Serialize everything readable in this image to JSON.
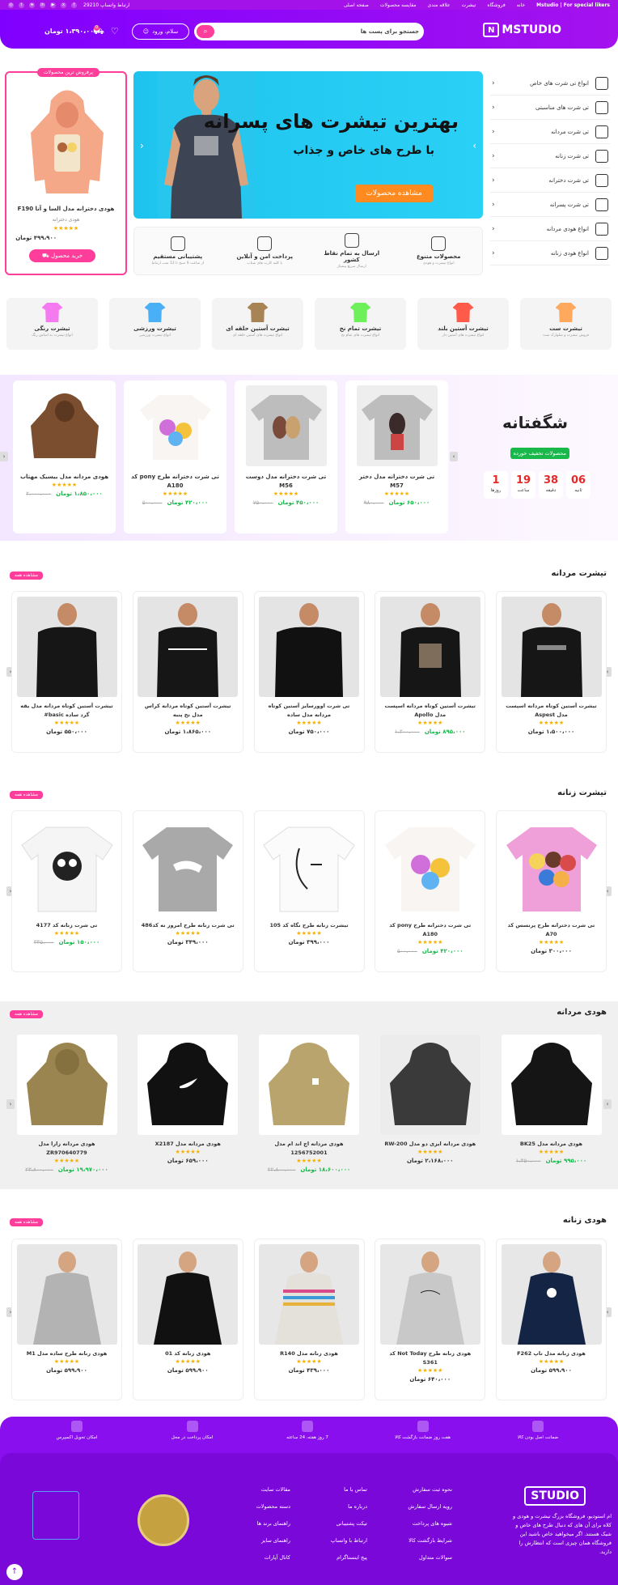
{
  "topbar": {
    "tagline": "Mstudio | For special likers",
    "links": [
      "خانه",
      "فروشگاه",
      "تیشرت",
      "علاقه مندی",
      "مقایسه محصولات",
      "صفحه اصلی"
    ],
    "phone": "ارتباط واتساپ 29210"
  },
  "header": {
    "logo": "MSTUDIO",
    "search_placeholder": "جستجو برای پست ها",
    "login": "سلام، ورود",
    "cart_count": "0",
    "cart_total": "۱،۳۹۰،۰۰۰ تومان"
  },
  "categories": [
    "انواع تی شرت های خاص",
    "تی شرت های مناسبتی",
    "تی شرت مردانه",
    "تی شرت زنانه",
    "تی شرت دخترانه",
    "تی شرت پسرانه",
    "انواع هودی مردانه",
    "انواع هودی زنانه"
  ],
  "banner": {
    "title": "بهترین تیشرت های پسرانه",
    "subtitle": "با طرح های خاص و جذاب",
    "cta": "مشاهده محصولات"
  },
  "features": [
    {
      "title": "محصولات متنوع",
      "sub": "انواع تیشرت و هودی"
    },
    {
      "title": "ارسال به تمام نقاط کشور",
      "sub": "ارسال سریع پیشتاز"
    },
    {
      "title": "پرداخت امن و آنلاین",
      "sub": "با کلیه کارت های شتاب"
    },
    {
      "title": "پشتیبانی مستقیم",
      "sub": "از ساعت 9 صبح تا 12 شب ارتباط"
    }
  ],
  "offer": {
    "tag": "پرفروش ترین محصولات",
    "name": "هودی دخترانه مدل السا و آنا F190",
    "sub": "هودی دخترانه",
    "price": "۴۹۹،۹۰۰ تومان",
    "buy": "خرید محصول"
  },
  "tiles": [
    {
      "title": "تیشرت ست",
      "sub": "فروش تیشرت و شلوارک ست"
    },
    {
      "title": "تیشرت آستین بلند",
      "sub": "انواع تیشرت های آستین دار"
    },
    {
      "title": "تیشرت تمام نخ",
      "sub": "انواع تیشرت های تمام نخ"
    },
    {
      "title": "تیشرت آستین حلقه ای",
      "sub": "انواع تیشرت های آستین حلقه ای"
    },
    {
      "title": "تیشرت ورزشی",
      "sub": "انواع تیشرت ورزشی"
    },
    {
      "title": "تیشرت رنگی",
      "sub": "انواع تیشرت به اساس رنگ"
    }
  ],
  "amazing": {
    "title": "شگفتانه",
    "badge": "محصولات تخفیف خورده",
    "timer": [
      {
        "value": "06",
        "label": "ثانیه"
      },
      {
        "value": "38",
        "label": "دقیقه"
      },
      {
        "value": "19",
        "label": "ساعت"
      },
      {
        "value": "1",
        "label": "روزها"
      }
    ],
    "products": [
      {
        "name": "هودی مردانه مدل بیسیک مهتاب",
        "old": "۲،۰۰۰،۰۰۰",
        "new": "۱،۸۵۰،۰۰۰ تومان"
      },
      {
        "name": "تی شرت دخترانه طرح pony کد A180",
        "old": "۵۰۰،۰۰۰",
        "new": "۴۲۰،۰۰۰ تومان"
      },
      {
        "name": "تی شرت دخترانه مدل دوست M56",
        "old": "۷۵۰،۰۰۰",
        "new": "۴۵۰،۰۰۰ تومان"
      },
      {
        "name": "تی شرت دخترانه مدل دختر M57",
        "old": "۹۸۰،۰۰۰",
        "new": "۶۵۰،۰۰۰ تومان"
      }
    ]
  },
  "sections": [
    {
      "title": "تیشرت مردانه",
      "more": "مشاهده همه",
      "products": [
        {
          "name": "تیشرت آستین کوتاه مردانه مدل یقه گرد ساده basic#",
          "old": "",
          "price": "۵۵۰،۰۰۰ تومان"
        },
        {
          "name": "تیشرت آستین کوتاه مردانه کراس مدل نخ پنبه",
          "old": "",
          "price": "۱،۸۶۵،۰۰۰ تومان"
        },
        {
          "name": "تی شرت اوورسایز آستین کوتاه مردانه مدل ساده",
          "old": "",
          "price": "۷۵۰،۰۰۰ تومان"
        },
        {
          "name": "تیشرت آستین کوتاه مردانه اسپست مدل Apollo",
          "old": "۱،۲۰۰،۰۰۰",
          "price": "۸۹۵،۰۰۰ تومان"
        },
        {
          "name": "تیشرت آستین کوتاه مردانه اسپست مدل Aspest",
          "old": "",
          "price": "۱،۵۰۰،۰۰۰ تومان"
        }
      ]
    },
    {
      "title": "تیشرت زنانه",
      "more": "مشاهده همه",
      "products": [
        {
          "name": "تی شرت زنانه کد 4177",
          "old": "۳۳۵،۰۰۰",
          "price": "۱۵۰،۰۰۰ تومان"
        },
        {
          "name": "تی شرت زنانه طرح امروز نه کد486",
          "old": "",
          "price": "۳۴۹،۰۰۰ تومان"
        },
        {
          "name": "تیشرت زنانه طرح نگاه کد 105",
          "old": "",
          "price": "۳۹۹،۰۰۰ تومان"
        },
        {
          "name": "تی شرت دخترانه طرح pony کد A180",
          "old": "۵۰۰،۰۰۰",
          "price": "۴۲۰،۰۰۰ تومان"
        },
        {
          "name": "تی شرت دخترانه طرح پرنسس کد A70",
          "old": "",
          "price": "۳۰۰،۰۰۰ تومان"
        }
      ]
    },
    {
      "title": "هودی مردانه",
      "more": "مشاهده همه",
      "products": [
        {
          "name": "هودی مردانه زارا مدل ZR970640779",
          "old": "۲۳،۸۰۰،۰۰۰",
          "price": "۱۹،۹۷۰،۰۰۰ تومان"
        },
        {
          "name": "هودی مردانه مدل X2187",
          "old": "",
          "price": "۶۵۹،۰۰۰ تومان"
        },
        {
          "name": "هودی مردانه اچ اند ام مدل 1256752001",
          "old": "۲۲،۸۰۰،۰۰۰",
          "price": "۱۸،۶۰۰،۰۰۰ تومان"
        },
        {
          "name": "هودی مردانه ایزی دو مدل RW-200",
          "old": "",
          "price": "۲،۱۶۸،۰۰۰ تومان"
        },
        {
          "name": "هودی مردانه مدل BK25",
          "old": "۱،۴۵۰،۰۰۰",
          "price": "۹۹۵،۰۰۰ تومان"
        }
      ]
    },
    {
      "title": "هودی زنانه",
      "more": "مشاهده همه",
      "products": [
        {
          "name": "هودی زنانه طرح ساده مدل M1",
          "old": "",
          "price": "۵۹۹،۹۰۰ تومان"
        },
        {
          "name": "هودی زنانه کد 01",
          "old": "",
          "price": "۵۹۹،۹۰۰ تومان"
        },
        {
          "name": "هودی زنانه مدل R140",
          "old": "",
          "price": "۴۳۹،۰۰۰ تومان"
        },
        {
          "name": "هودی زنانه طرح Not Today کد S361",
          "old": "",
          "price": "۶۴۰،۰۰۰ تومان"
        },
        {
          "name": "هودی زنانه مدل تاپ F262",
          "old": "",
          "price": "۵۹۹،۹۰۰ تومان"
        }
      ]
    }
  ],
  "footer": {
    "bar": [
      "امکان تحویل اکسپرس",
      "امکان پرداخت در محل",
      "7 روز هفته، 24 ساعته",
      "هفت روز ضمانت بازگشت کالا",
      "ضمانت اصل بودن کالا"
    ],
    "logo": "STUDIO",
    "about": "ام استودیو، فروشگاه بزرگ تیشرت و هودی و کلاه برای آن های که دنبال طرح های خاص و شیک هستند. اگر میخواهید خاص باشید این فروشگاه همان چیزی است که انتظارش را دارید.",
    "col1": [
      "نحوه ثبت سفارش",
      "رویه ارسال سفارش",
      "شیوه های پرداخت",
      "شرایط بازگشت کالا",
      "سوالات متداول"
    ],
    "col2": [
      "تماس با ما",
      "درباره ما",
      "تیکت پشتیبانی",
      "ارتباط با واتساپ",
      "پیج اینستاگرام"
    ],
    "col3": [
      "مقالات سایت",
      "دسته محصولات",
      "راهنمای برند ها",
      "راهنمای سایز",
      "کانال آپارات"
    ]
  }
}
